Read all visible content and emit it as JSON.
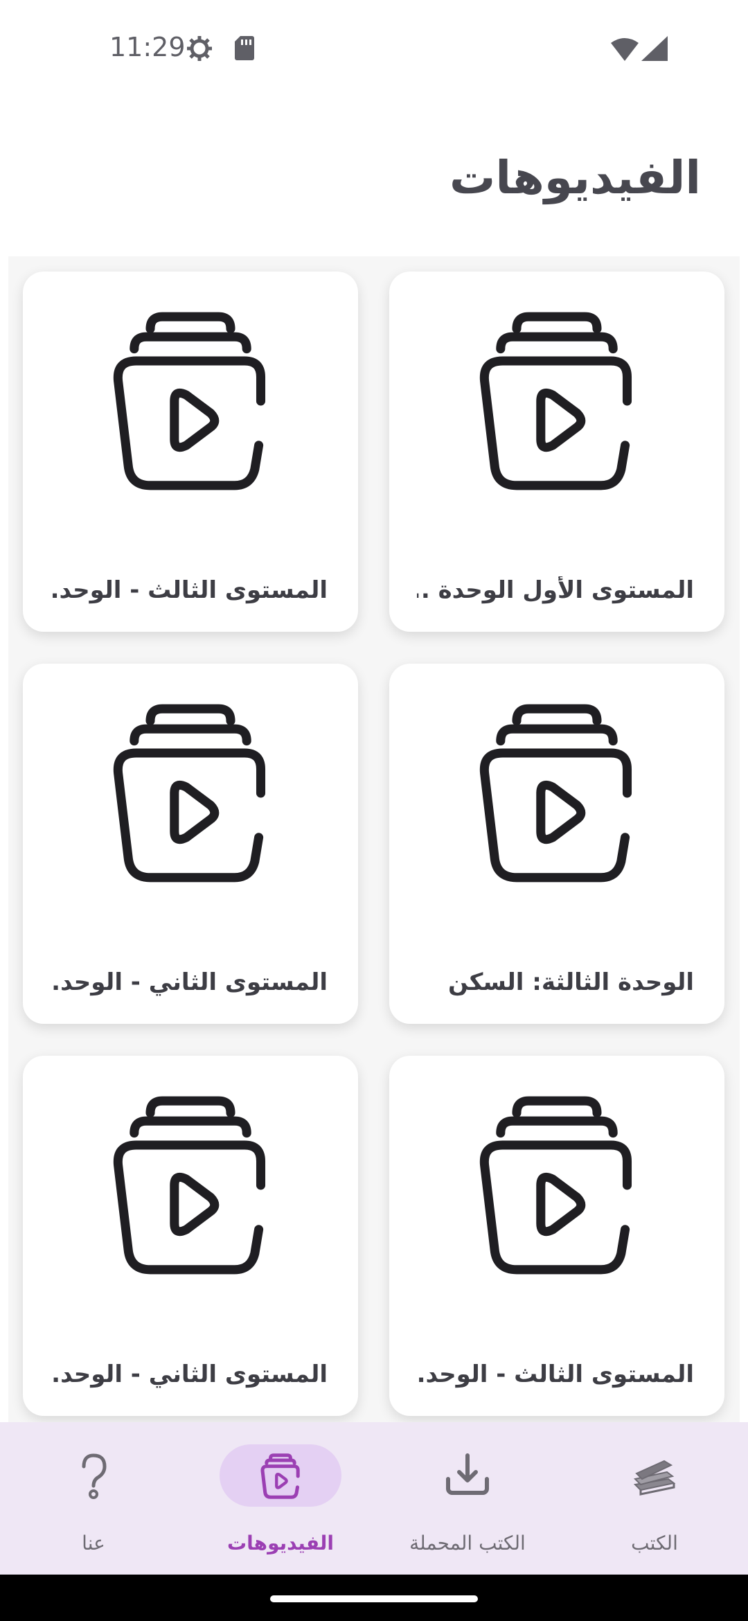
{
  "status_bar": {
    "time": "11:29",
    "icons": [
      "settings-gear-icon",
      "sd-card-icon",
      "wifi-icon",
      "cellular-signal-icon"
    ]
  },
  "header": {
    "title": "الفيديوهات"
  },
  "cards": [
    {
      "label": "المستوى الأول الوحدة ...",
      "icon": "video-library-icon"
    },
    {
      "label": "المستوى الثالث - الوحد...",
      "icon": "video-library-icon"
    },
    {
      "label": "الوحدة الثالثة: السكن",
      "icon": "video-library-icon"
    },
    {
      "label": "المستوى الثاني - الوحد...",
      "icon": "video-library-icon"
    },
    {
      "label": "المستوى الثالث - الوحد...",
      "icon": "video-library-icon"
    },
    {
      "label": "المستوى الثاني - الوحد...",
      "icon": "video-library-icon"
    }
  ],
  "bottom_nav": {
    "items": [
      {
        "label": "الكتب",
        "icon": "books-icon",
        "active": false
      },
      {
        "label": "الكتب المحملة",
        "icon": "download-tray-icon",
        "active": false
      },
      {
        "label": "الفيديوهات",
        "icon": "video-library-icon",
        "active": true
      },
      {
        "label": "عنا",
        "icon": "question-mark-icon",
        "active": false
      }
    ]
  },
  "colors": {
    "active_nav": "#9b3fb3",
    "active_pill": "#e4d0f3",
    "nav_background": "#efe7f5",
    "title_text": "#47474f"
  }
}
